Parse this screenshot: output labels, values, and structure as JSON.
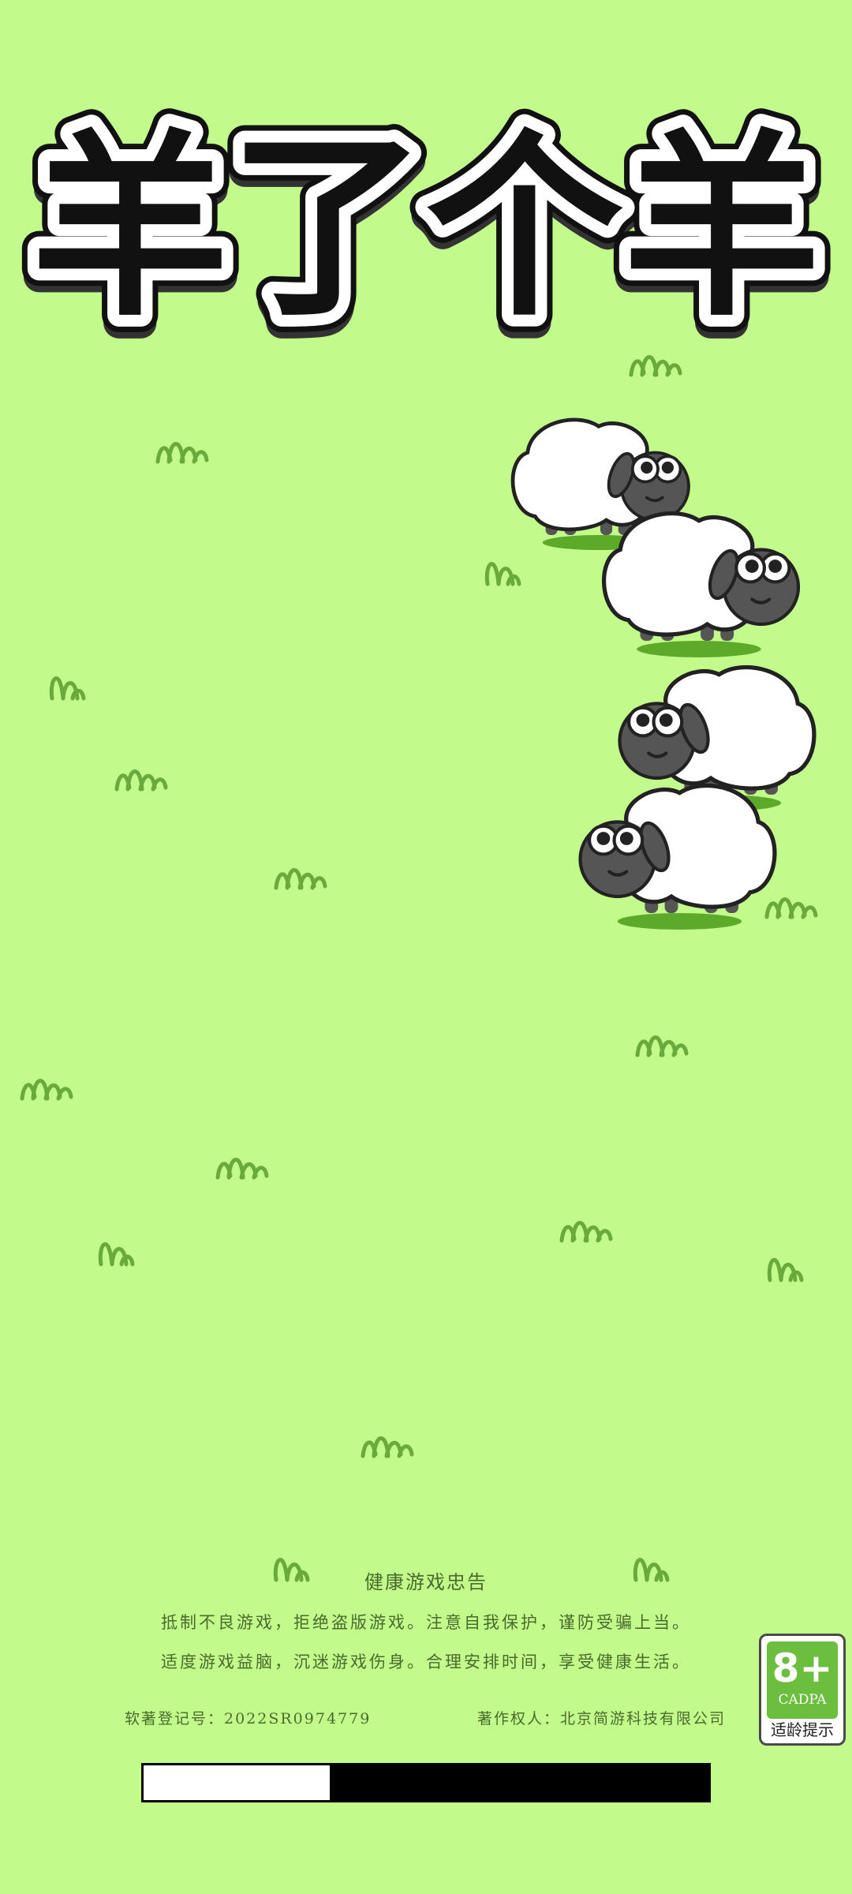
{
  "game": {
    "title": "羊了个羊",
    "background_color": "#c2fa8c"
  },
  "health_notice": {
    "title": "健康游戏忠告",
    "line1": "抵制不良游戏，拒绝盗版游戏。注意自我保护，谨防受骗上当。",
    "line2": "适度游戏益脑，沉迷游戏伤身。合理安排时间，享受健康生活。"
  },
  "registration": {
    "software_copyright": "软著登记号：2022SR0974779",
    "copyright_owner": "著作权人：北京简游科技有限公司"
  },
  "loading": {
    "progress": 0.33
  },
  "age_rating": {
    "label": "8+",
    "org": "CADPA",
    "tip": "适龄提示"
  },
  "icons": [
    "sheep-icon",
    "grass-tuft-icon"
  ]
}
